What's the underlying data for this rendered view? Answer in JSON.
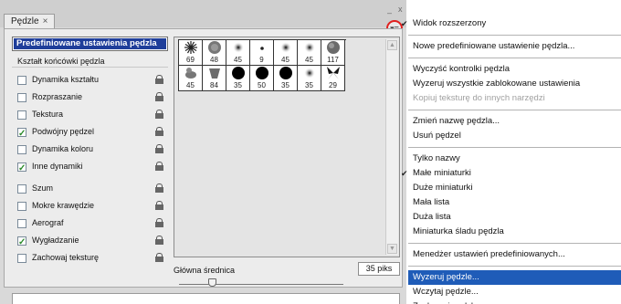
{
  "panel": {
    "tab_label": "Pędzle",
    "tab_close": "×",
    "window_min": "–",
    "window_close": "x",
    "menu_glyph": "▾≡",
    "preset_button": "Predefiniowane ustawienia pędzla",
    "section_label": "Kształt końcówki pędzla",
    "options": [
      {
        "label": "Dynamika kształtu",
        "checked": false
      },
      {
        "label": "Rozpraszanie",
        "checked": false
      },
      {
        "label": "Tekstura",
        "checked": false
      },
      {
        "label": "Podwójny pędzel",
        "checked": true
      },
      {
        "label": "Dynamika koloru",
        "checked": false
      },
      {
        "label": "Inne dynamiki",
        "checked": true
      },
      {
        "label": "Szum",
        "checked": false
      },
      {
        "label": "Mokre krawędzie",
        "checked": false
      },
      {
        "label": "Aerograf",
        "checked": false
      },
      {
        "label": "Wygładzanie",
        "checked": true
      },
      {
        "label": "Zachowaj teksturę",
        "checked": false
      }
    ],
    "brushes": [
      {
        "size": "69",
        "shape": "star-burst-icon"
      },
      {
        "size": "48",
        "shape": "soft-blob-icon"
      },
      {
        "size": "45",
        "shape": "soft-dot-icon"
      },
      {
        "size": "9",
        "shape": "tiny-dot-icon"
      },
      {
        "size": "45",
        "shape": "soft-dot-icon"
      },
      {
        "size": "45",
        "shape": "soft-dot-icon"
      },
      {
        "size": "117",
        "shape": "rough-blob-icon"
      },
      {
        "size": "45",
        "shape": "duck-icon"
      },
      {
        "size": "84",
        "shape": "leaf-icon"
      },
      {
        "size": "35",
        "shape": "hard-dot-icon"
      },
      {
        "size": "50",
        "shape": "hard-dot-icon"
      },
      {
        "size": "35",
        "shape": "hard-dot-icon"
      },
      {
        "size": "35",
        "shape": "soft-dot-icon"
      },
      {
        "size": "29",
        "shape": "butterfly-icon"
      }
    ],
    "diameter_label": "Główna średnica",
    "diameter_value": "35 piks"
  },
  "menu": {
    "items": [
      {
        "label": "Widok rozszerzony",
        "checked": true
      },
      {
        "sep": true
      },
      {
        "label": "Nowe predefiniowane ustawienie pędzla..."
      },
      {
        "sep": true
      },
      {
        "label": "Wyczyść kontrolki pędzla"
      },
      {
        "label": "Wyzeruj wszystkie zablokowane ustawienia"
      },
      {
        "label": "Kopiuj teksturę do innych narzędzi",
        "disabled": true
      },
      {
        "sep": true
      },
      {
        "label": "Zmień  nazwę pędzla..."
      },
      {
        "label": "Usuń pędzel"
      },
      {
        "sep": true
      },
      {
        "label": "Tylko nazwy"
      },
      {
        "label": "Małe miniaturki",
        "checked": true
      },
      {
        "label": "Duże miniaturki"
      },
      {
        "label": "Mała lista"
      },
      {
        "label": "Duża lista"
      },
      {
        "label": "Miniaturka śladu pędzla"
      },
      {
        "sep": true
      },
      {
        "label": "Menedżer ustawień predefiniowanych..."
      },
      {
        "sep": true
      },
      {
        "label": "Wyzeruj pędzle...",
        "highlight": true
      },
      {
        "label": "Wczytaj pędzle..."
      },
      {
        "label": "Zachowaj pędzle..."
      }
    ]
  },
  "colors": {
    "highlight": "#1f5cb8",
    "preset_button_bg": "#1f3e9a",
    "menu_button_ring": "#e0201e"
  }
}
